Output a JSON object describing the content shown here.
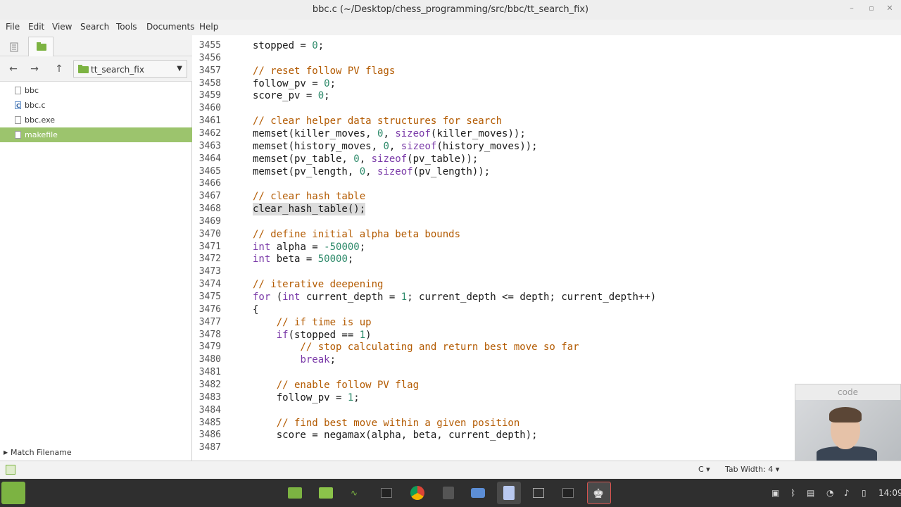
{
  "window": {
    "title": "bbc.c (~/Desktop/chess_programming/src/bbc/tt_search_fix)"
  },
  "menu": [
    "File",
    "Edit",
    "View",
    "Search",
    "Tools",
    "Documents",
    "Help"
  ],
  "sidepanel": {
    "folder": "tt_search_fix",
    "files": [
      {
        "name": "bbc",
        "type": "file",
        "selected": false
      },
      {
        "name": "bbc.c",
        "type": "c-file",
        "selected": false
      },
      {
        "name": "bbc.exe",
        "type": "file",
        "selected": false
      },
      {
        "name": "makefile",
        "type": "file",
        "selected": true
      }
    ],
    "match_filename": "Match Filename"
  },
  "editor": {
    "lines": [
      {
        "n": "3455",
        "text": "stopped = 0;"
      },
      {
        "n": "3456",
        "text": ""
      },
      {
        "n": "3457",
        "text": "// reset follow PV flags"
      },
      {
        "n": "3458",
        "text": "follow_pv = 0;"
      },
      {
        "n": "3459",
        "text": "score_pv = 0;"
      },
      {
        "n": "3460",
        "text": ""
      },
      {
        "n": "3461",
        "text": "// clear helper data structures for search"
      },
      {
        "n": "3462",
        "text": "memset(killer_moves, 0, sizeof(killer_moves));"
      },
      {
        "n": "3463",
        "text": "memset(history_moves, 0, sizeof(history_moves));"
      },
      {
        "n": "3464",
        "text": "memset(pv_table, 0, sizeof(pv_table));"
      },
      {
        "n": "3465",
        "text": "memset(pv_length, 0, sizeof(pv_length));"
      },
      {
        "n": "3466",
        "text": ""
      },
      {
        "n": "3467",
        "text": "// clear hash table"
      },
      {
        "n": "3468",
        "text": "clear_hash_table();"
      },
      {
        "n": "3469",
        "text": ""
      },
      {
        "n": "3470",
        "text": "// define initial alpha beta bounds"
      },
      {
        "n": "3471",
        "text": "int alpha = -50000;"
      },
      {
        "n": "3472",
        "text": "int beta = 50000;"
      },
      {
        "n": "3473",
        "text": ""
      },
      {
        "n": "3474",
        "text": "// iterative deepening"
      },
      {
        "n": "3475",
        "text": "for (int current_depth = 1; current_depth <= depth; current_depth++)"
      },
      {
        "n": "3476",
        "text": "{"
      },
      {
        "n": "3477",
        "text": "    // if time is up"
      },
      {
        "n": "3478",
        "text": "    if(stopped == 1)"
      },
      {
        "n": "3479",
        "text": "        // stop calculating and return best move so far"
      },
      {
        "n": "3480",
        "text": "        break;"
      },
      {
        "n": "3481",
        "text": ""
      },
      {
        "n": "3482",
        "text": "    // enable follow PV flag"
      },
      {
        "n": "3483",
        "text": "    follow_pv = 1;"
      },
      {
        "n": "3484",
        "text": ""
      },
      {
        "n": "3485",
        "text": "    // find best move within a given position"
      },
      {
        "n": "3486",
        "text": "    score = negamax(alpha, beta, current_depth);"
      },
      {
        "n": "3487",
        "text": ""
      }
    ],
    "highlighted_line": "3468"
  },
  "statusbar": {
    "language": "C",
    "tab_width": "Tab Width: 4"
  },
  "webcam": {
    "title": "code"
  },
  "taskbar": {
    "clock": "14:09"
  },
  "colors": {
    "selection": "#9cc46d",
    "comment": "#b35a00",
    "number": "#2d8a6a",
    "keyword": "#7a3aa8"
  }
}
